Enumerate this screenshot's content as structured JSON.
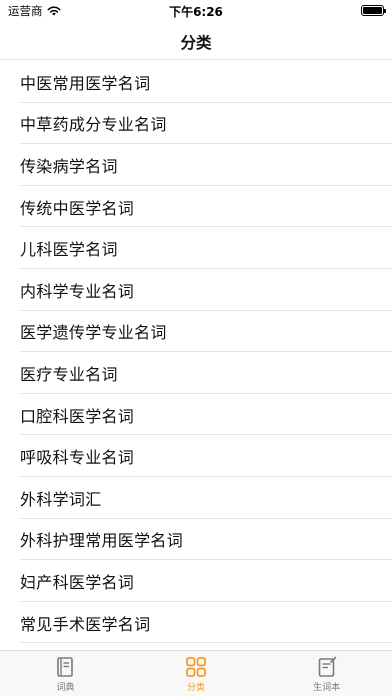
{
  "status_bar": {
    "carrier": "运营商",
    "time": "下午6:26",
    "icons": [
      "wifi-icon",
      "battery-icon"
    ]
  },
  "nav": {
    "title": "分类"
  },
  "categories": [
    "中医常用医学名词",
    "中草药成分专业名词",
    "传染病学名词",
    "传统中医学名词",
    "儿科医学名词",
    "内科学专业名词",
    "医学遗传学专业名词",
    "医疗专业名词",
    "口腔科医学名词",
    "呼吸科专业名词",
    "外科学词汇",
    "外科护理常用医学名词",
    "妇产科医学名词",
    "常见手术医学名词"
  ],
  "tabs": [
    {
      "label": "词典",
      "icon": "book-icon",
      "active": false
    },
    {
      "label": "分类",
      "icon": "grid-icon",
      "active": true
    },
    {
      "label": "生词本",
      "icon": "notebook-icon",
      "active": false
    }
  ],
  "colors": {
    "accent": "#f19a20",
    "inactive": "#7a7a7a"
  }
}
